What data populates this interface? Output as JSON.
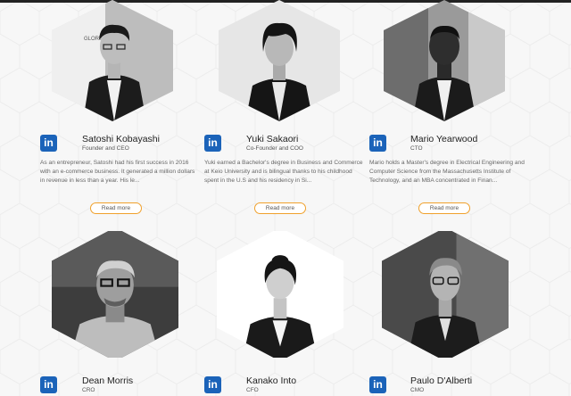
{
  "team": {
    "members": [
      {
        "name": "Satoshi Kobayashi",
        "role": "Founder and CEO",
        "bio": "As an entrepreneur, Satoshi had his first success in 2016 with an e-commerce business. It generated a million dollars in revenue in less than a year. His le...",
        "read_more": "Read more",
        "linkedin": "in"
      },
      {
        "name": "Yuki Sakaori",
        "role": "Co-Founder and COO",
        "bio": "Yuki earned a Bachelor's degree in Business and Commerce at Keio University and is bilingual thanks to his childhood spent in the U.S and his residency in Si...",
        "read_more": "Read more",
        "linkedin": "in"
      },
      {
        "name": "Mario Yearwood",
        "role": "CTO",
        "bio": "Mario holds a Master's degree in Electrical Engineering and Computer Science from the Massachusetts Institute of Technology, and an MBA concentrated in Finan...",
        "read_more": "Read more",
        "linkedin": "in"
      },
      {
        "name": "Dean Morris",
        "role": "CRO",
        "linkedin": "in"
      },
      {
        "name": "Kanako Into",
        "role": "CFO",
        "linkedin": "in"
      },
      {
        "name": "Paulo D'Alberti",
        "role": "CMO",
        "linkedin": "in"
      }
    ]
  },
  "photo_labels": {
    "wall_text": "GLORY"
  },
  "colors": {
    "linkedin": "#1b63b9",
    "button_border": "#f0a12c",
    "background": "#f7f7f7"
  }
}
